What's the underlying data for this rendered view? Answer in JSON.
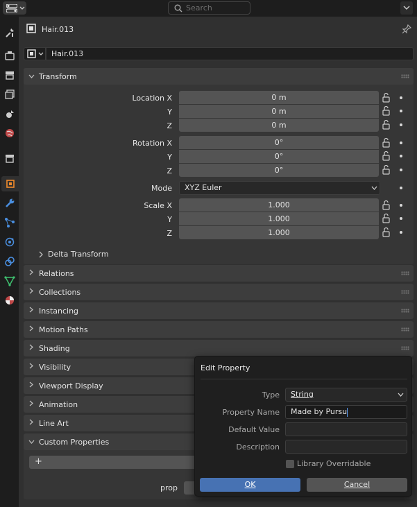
{
  "topbar": {
    "search_placeholder": "Search"
  },
  "header": {
    "object_name": "Hair.013",
    "datablock_name": "Hair.013"
  },
  "transform": {
    "title": "Transform",
    "location_label": "Location X",
    "y_label": "Y",
    "z_label": "Z",
    "location": [
      "0 m",
      "0 m",
      "0 m"
    ],
    "rotation_label": "Rotation X",
    "rotation": [
      "0°",
      "0°",
      "0°"
    ],
    "mode_label": "Mode",
    "mode_value": "XYZ Euler",
    "scale_label": "Scale X",
    "scale": [
      "1.000",
      "1.000",
      "1.000"
    ],
    "delta": "Delta Transform"
  },
  "panels": [
    "Relations",
    "Collections",
    "Instancing",
    "Motion Paths",
    "Shading",
    "Visibility",
    "Viewport Display",
    "Animation",
    "Line Art",
    "Custom Properties"
  ],
  "custom_props": {
    "add_label": "+",
    "prop_label": "prop"
  },
  "popup": {
    "title": "Edit Property",
    "type_label": "Type",
    "type_value": "String",
    "name_label": "Property Name",
    "name_value": "Made by Pursu",
    "default_label": "Default Value",
    "default_value": "",
    "desc_label": "Description",
    "desc_value": "",
    "override_label": "Library Overridable",
    "ok_label": "OK",
    "cancel_label": "Cancel"
  },
  "colors": {
    "accent": "#4772b3",
    "panel": "#3d3d3d",
    "field": "#545454"
  }
}
